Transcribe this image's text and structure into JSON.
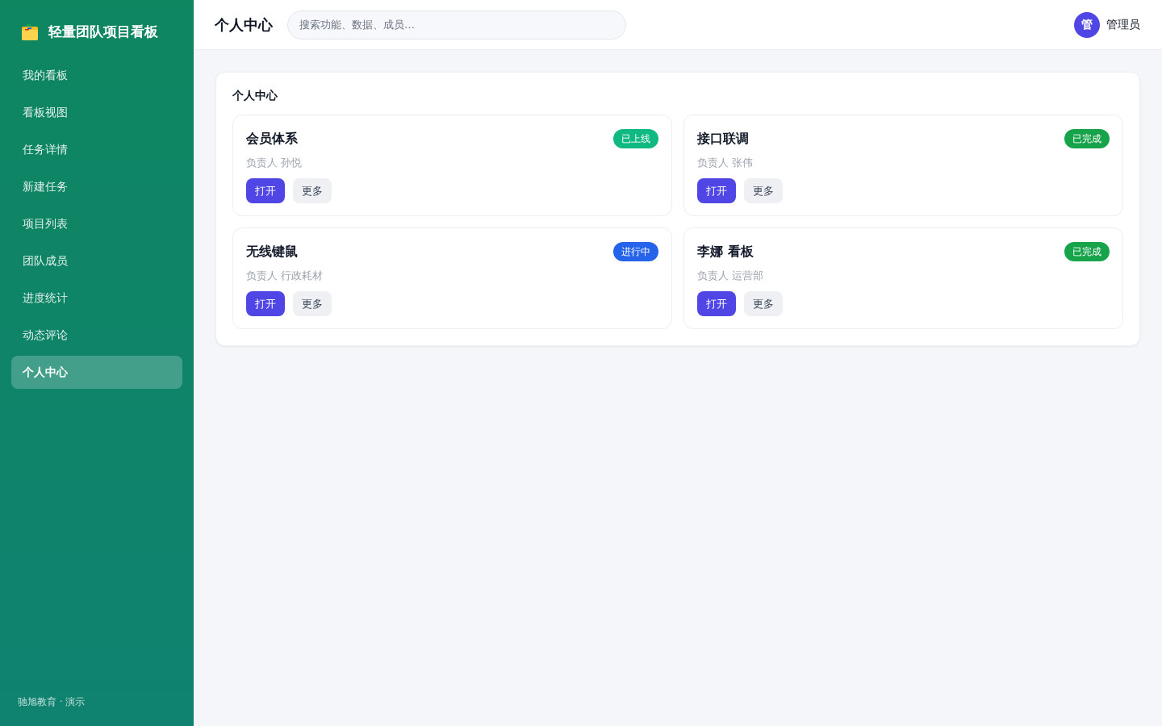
{
  "sidebar": {
    "logo_text": "轻量团队项目看板",
    "items": [
      {
        "label": "我的看板",
        "selected": false
      },
      {
        "label": "看板视图",
        "selected": false
      },
      {
        "label": "任务详情",
        "selected": false
      },
      {
        "label": "新建任务",
        "selected": false
      },
      {
        "label": "项目列表",
        "selected": false
      },
      {
        "label": "团队成员",
        "selected": false
      },
      {
        "label": "进度统计",
        "selected": false
      },
      {
        "label": "动态评论",
        "selected": false
      },
      {
        "label": "个人中心",
        "selected": true
      }
    ],
    "footer": "驰旭教育 · 演示"
  },
  "topbar": {
    "title": "个人中心",
    "search": {
      "placeholder": "搜索功能、数据、成员…"
    },
    "user": {
      "avatar": "管",
      "name": "管理员"
    }
  },
  "panel": {
    "title": "个人中心",
    "cards": [
      {
        "title": "会员体系",
        "status": {
          "label": "已上线",
          "color": "#10b981"
        },
        "owner": "负责人 孙悦",
        "buttons": [
          {
            "label": "打开",
            "kind": "primary"
          },
          {
            "label": "更多",
            "kind": "secondary"
          }
        ]
      },
      {
        "title": "接口联调",
        "status": {
          "label": "已完成",
          "color": "#16a34a"
        },
        "owner": "负责人 张伟",
        "buttons": [
          {
            "label": "打开",
            "kind": "primary"
          },
          {
            "label": "更多",
            "kind": "secondary"
          }
        ]
      },
      {
        "title": "无线键鼠",
        "status": {
          "label": "进行中",
          "color": "#2563eb"
        },
        "owner": "负责人 行政耗材",
        "buttons": [
          {
            "label": "打开",
            "kind": "primary"
          },
          {
            "label": "更多",
            "kind": "secondary"
          }
        ]
      },
      {
        "title": "李娜 看板",
        "status": {
          "label": "已完成",
          "color": "#16a34a"
        },
        "owner": "负责人 运营部",
        "buttons": [
          {
            "label": "打开",
            "kind": "primary"
          },
          {
            "label": "更多",
            "kind": "secondary"
          }
        ]
      }
    ]
  }
}
